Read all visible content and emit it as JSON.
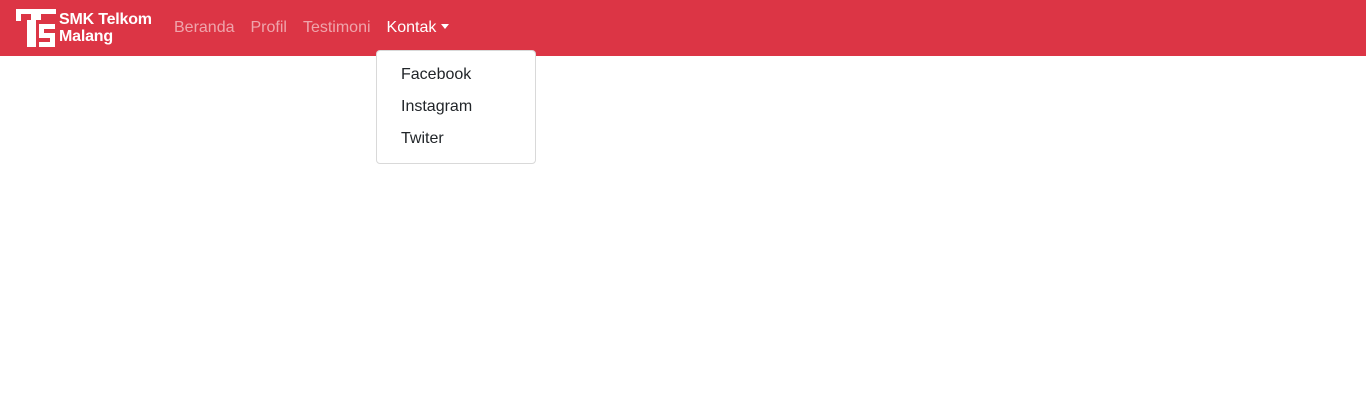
{
  "brand": {
    "line1": "SMK Telkom",
    "line2": "Malang",
    "logo_icon": "ts-logo-icon",
    "color": "#dc3545"
  },
  "nav": {
    "items": [
      {
        "label": "Beranda",
        "active": false
      },
      {
        "label": "Profil",
        "active": false
      },
      {
        "label": "Testimoni",
        "active": false
      },
      {
        "label": "Kontak",
        "active": true,
        "has_dropdown": true
      }
    ]
  },
  "dropdown": {
    "open": true,
    "items": [
      {
        "label": "Facebook"
      },
      {
        "label": "Instagram"
      },
      {
        "label": "Twiter"
      }
    ]
  }
}
